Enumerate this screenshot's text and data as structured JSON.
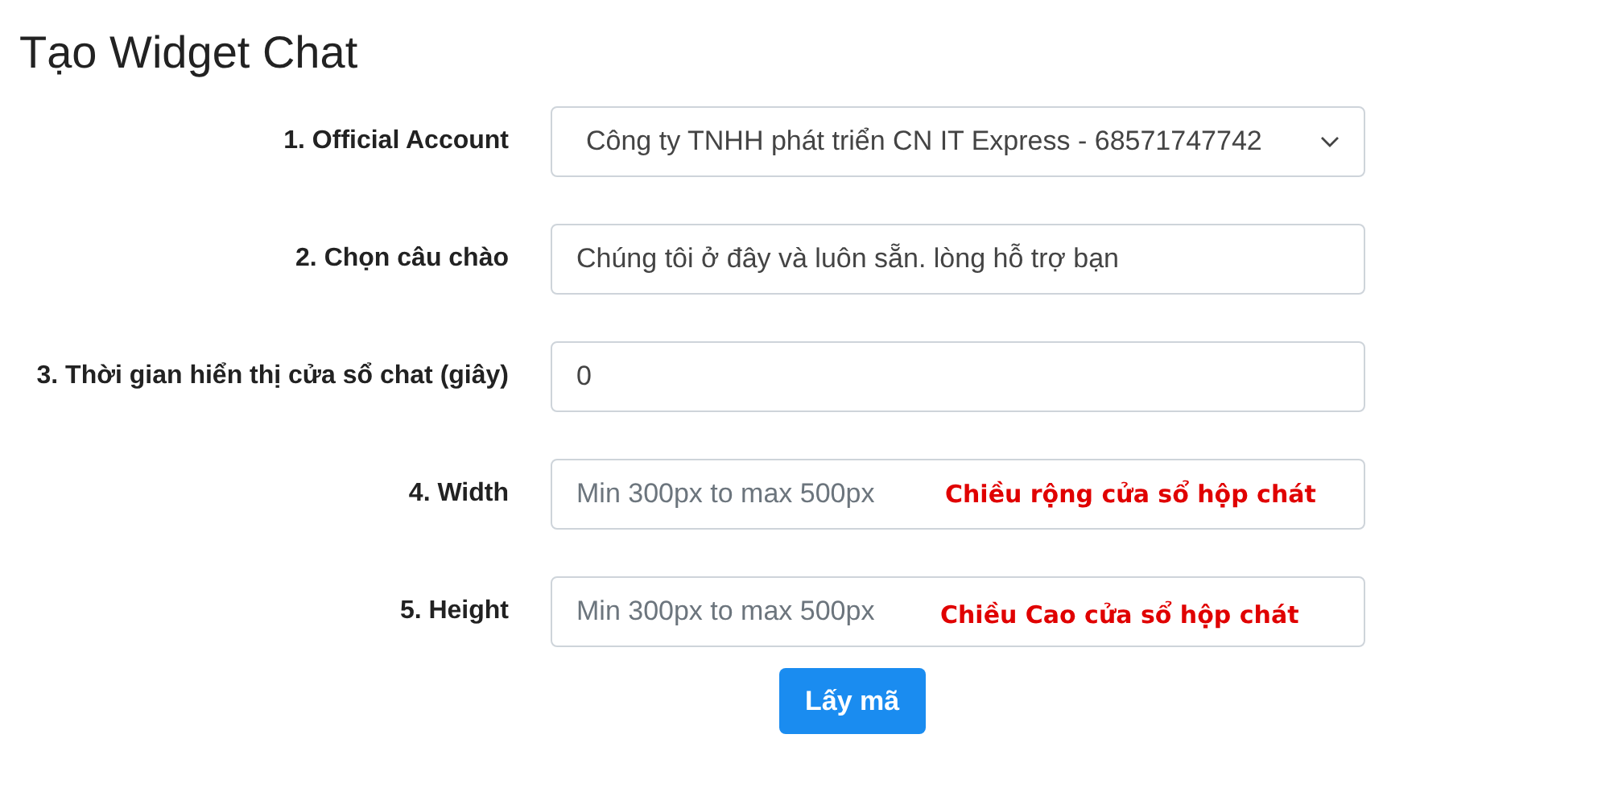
{
  "title": "Tạo Widget Chat",
  "fields": [
    {
      "kind": "select",
      "label": "1. Official Account",
      "value": "Công ty TNHH phát triển CN IT Express - 68571747742"
    },
    {
      "kind": "input",
      "label": "2. Chọn câu chào",
      "value": "Chúng tôi ở đây và luôn sẵn. lòng hỗ trợ bạn"
    },
    {
      "kind": "input",
      "label": "3. Thời gian hiển thị cửa sổ chat (giây)",
      "value": "0"
    },
    {
      "kind": "input",
      "label": "4. Width",
      "placeholder": "Min 300px to max 500px",
      "note": "Chiều rộng cửa sổ hộp chát"
    },
    {
      "kind": "input",
      "label": "5. Height",
      "placeholder": "Min 300px to max 500px",
      "note": "Chiều Cao cửa sổ hộp chát"
    }
  ],
  "button": "Lấy mã"
}
